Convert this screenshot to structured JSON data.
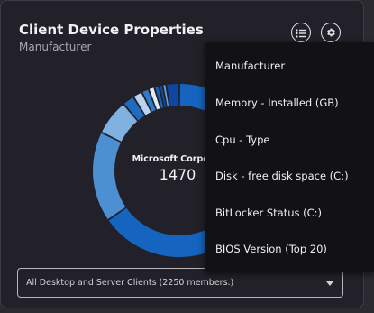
{
  "card": {
    "title": "Client Device Properties",
    "subtitle": "Manufacturer"
  },
  "toolbar": {
    "list_icon": "list-icon",
    "settings_icon": "gear-icon"
  },
  "donut": {
    "center_label": "Microsoft Corporat",
    "center_value": "1470"
  },
  "chart_data": {
    "type": "pie",
    "center_label": "Microsoft Corporat",
    "center_value": 1470,
    "total": 2250,
    "slices": [
      {
        "value": 1470,
        "color": "#1565c0"
      },
      {
        "value": 380,
        "color": "#4c90d2"
      },
      {
        "value": 150,
        "color": "#7fb2e0"
      },
      {
        "value": 50,
        "color": "#1f6bbd"
      },
      {
        "value": 40,
        "color": "#b8d4ef"
      },
      {
        "value": 30,
        "color": "#2e7acb"
      },
      {
        "value": 25,
        "color": "#e1ecf7"
      },
      {
        "value": 20,
        "color": "#1a5fb0"
      },
      {
        "value": 15,
        "color": "#0f4fa0"
      },
      {
        "value": 15,
        "color": "#5fa0dc"
      },
      {
        "value": 55,
        "color": "#0d47a1"
      }
    ]
  },
  "select": {
    "value": "All Desktop and Server Clients (2250 members.)"
  },
  "menu": {
    "items": [
      "Manufacturer",
      "Memory - Installed (GB)",
      "Cpu - Type",
      "Disk - free disk space (C:)",
      "BitLocker Status (C:)",
      "BIOS Version (Top 20)"
    ]
  }
}
